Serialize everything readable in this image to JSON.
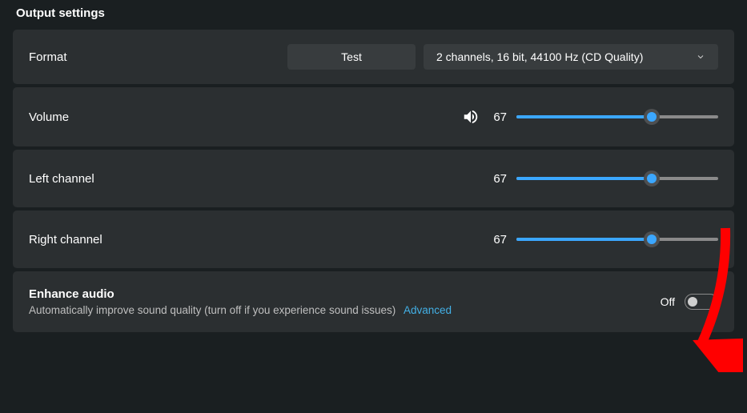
{
  "section_title": "Output settings",
  "format": {
    "label": "Format",
    "test_button": "Test",
    "selected": "2 channels, 16 bit, 44100 Hz (CD Quality)"
  },
  "volume": {
    "label": "Volume",
    "value": "67",
    "percent": 67
  },
  "left_channel": {
    "label": "Left channel",
    "value": "67",
    "percent": 67
  },
  "right_channel": {
    "label": "Right channel",
    "value": "67",
    "percent": 67
  },
  "enhance": {
    "title": "Enhance audio",
    "subtitle": "Automatically improve sound quality (turn off if you experience sound issues)",
    "advanced": "Advanced",
    "state_label": "Off",
    "state": false
  }
}
